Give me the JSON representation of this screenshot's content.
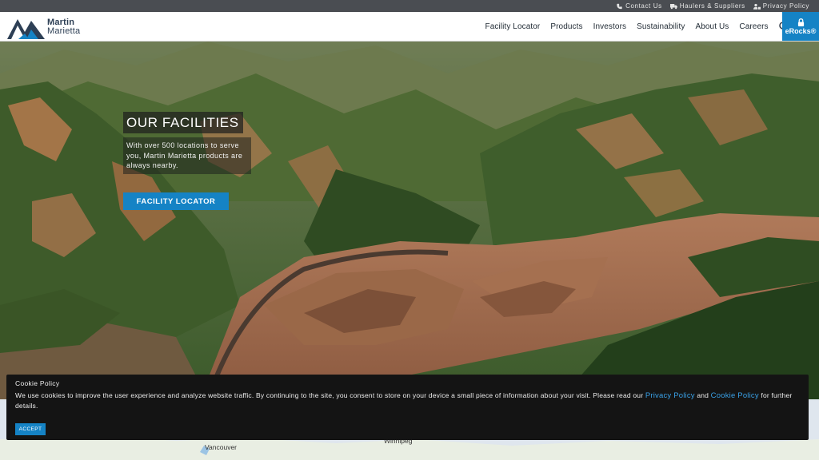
{
  "utility": {
    "contact": "Contact Us",
    "haulers": "Haulers & Suppliers",
    "privacy": "Privacy Policy"
  },
  "logo": {
    "line1": "Martin",
    "line2": "Marietta"
  },
  "nav": {
    "items": [
      "Facility Locator",
      "Products",
      "Investors",
      "Sustainability",
      "About Us",
      "Careers"
    ],
    "erocks": "eRocks®"
  },
  "hero": {
    "title": "OUR FACILITIES",
    "description": "With over 500 locations to serve you, Martin Marietta products are always nearby.",
    "cta": "FACILITY LOCATOR"
  },
  "map": {
    "label_vancouver": "Vancouver",
    "label_winnipeg": "Winnipeg"
  },
  "cookie": {
    "title": "Cookie Policy",
    "text_before": "We use cookies to improve the user experience and analyze website traffic. By continuing to the site, you consent to store on your device a small piece of information about your visit. Please read our ",
    "privacy_link": "Privacy Policy",
    "and": " and ",
    "cookie_link": "Cookie Policy",
    "text_after": " for further details.",
    "accept": "ACCEPT"
  },
  "colors": {
    "brand_blue": "#1583c5",
    "utility_bar": "#4a4d52",
    "cookie_bg": "#141414"
  }
}
